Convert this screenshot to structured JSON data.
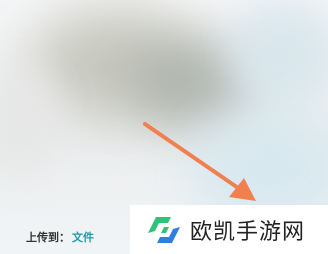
{
  "upload": {
    "label": "上传到：",
    "folder": "文件"
  },
  "watermark": {
    "text": "欧凯手游网",
    "logo_icon": "ok-logo-icon"
  },
  "annotation": {
    "arrow_icon": "arrow-pointer-icon",
    "color": "#f08050"
  },
  "colors": {
    "link": "#1a9fa8",
    "logo_green": "#2fc27a",
    "logo_blue": "#2f7fe0"
  }
}
